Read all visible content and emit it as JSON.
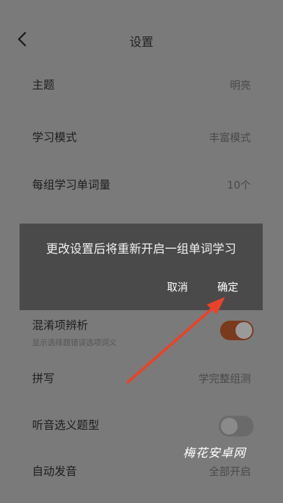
{
  "header": {
    "title": "设置",
    "back_icon": "chevron-left-icon"
  },
  "settings": [
    {
      "label": "主题",
      "value": "明亮"
    },
    {
      "label": "学习模式",
      "value": "丰富模式"
    },
    {
      "label": "每组学习单词量",
      "value": "10个"
    },
    {
      "label": "混淆项辨析",
      "sub": "显示选择题错误选项词义",
      "toggle": "on"
    },
    {
      "label": "拼写",
      "value": "学完整组测"
    },
    {
      "label": "听音选义题型",
      "toggle": "off"
    },
    {
      "label": "自动发音",
      "value": "全部开启"
    }
  ],
  "dialog": {
    "message": "更改设置后将重新开启一组单词学习",
    "cancel_label": "取消",
    "confirm_label": "确定"
  },
  "annotation": {
    "arrow_color": "#e8432a"
  },
  "watermark": "梅花安卓网",
  "colors": {
    "overlay": "#7a7a7a",
    "dialog_bg": "#4a4a4a",
    "toggle_on": "#7a3a1c"
  }
}
